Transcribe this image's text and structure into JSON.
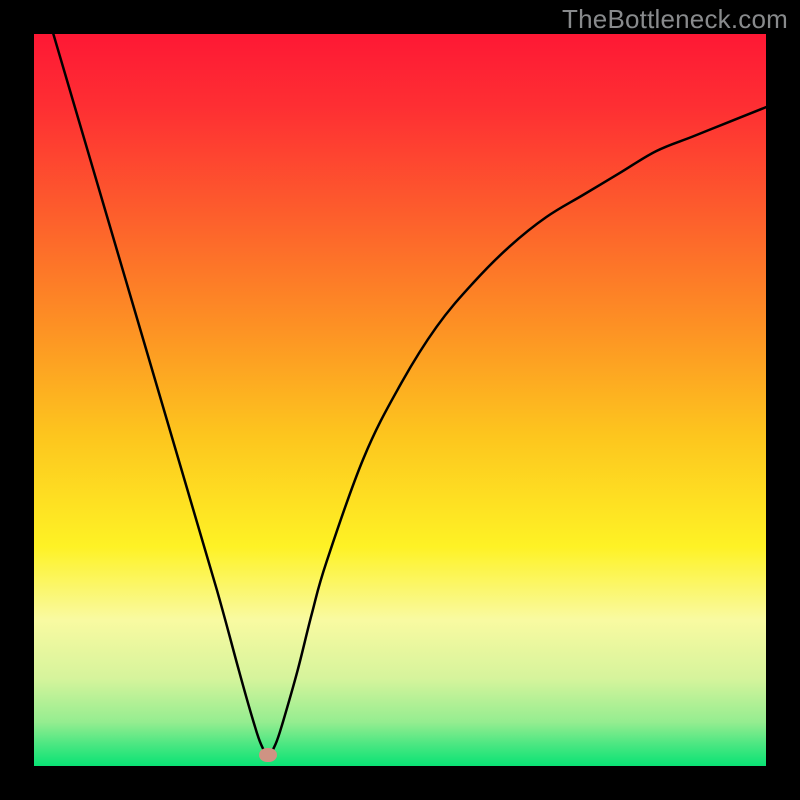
{
  "watermark": "TheBottleneck.com",
  "colors": {
    "frame": "#000000",
    "curve_stroke": "#000000",
    "marker": "#cf9383",
    "gradient_stops": [
      {
        "offset": 0.0,
        "color": "#fe1834"
      },
      {
        "offset": 0.1,
        "color": "#fe2f33"
      },
      {
        "offset": 0.25,
        "color": "#fd5f2c"
      },
      {
        "offset": 0.4,
        "color": "#fd9124"
      },
      {
        "offset": 0.55,
        "color": "#fdc61e"
      },
      {
        "offset": 0.7,
        "color": "#fef225"
      },
      {
        "offset": 0.8,
        "color": "#f9faa1"
      },
      {
        "offset": 0.88,
        "color": "#d6f49c"
      },
      {
        "offset": 0.94,
        "color": "#95ed90"
      },
      {
        "offset": 0.97,
        "color": "#4ce782"
      },
      {
        "offset": 1.0,
        "color": "#09e374"
      }
    ]
  },
  "chart_data": {
    "type": "line",
    "title": "",
    "xlabel": "",
    "ylabel": "",
    "xlim": [
      0,
      100
    ],
    "ylim": [
      0,
      100
    ],
    "grid": false,
    "legend": false,
    "series": [
      {
        "name": "bottleneck-curve",
        "x": [
          0,
          5,
          10,
          15,
          20,
          25,
          28,
          30,
          31,
          32,
          33,
          34,
          36,
          38,
          40,
          45,
          50,
          55,
          60,
          65,
          70,
          75,
          80,
          85,
          90,
          95,
          100
        ],
        "y": [
          109,
          92,
          75,
          58,
          41,
          24,
          13,
          6,
          3,
          1.5,
          3,
          6,
          13,
          21,
          28,
          42,
          52,
          60,
          66,
          71,
          75,
          78,
          81,
          84,
          86,
          88,
          90
        ]
      }
    ],
    "minimum_point": {
      "x": 32,
      "y": 1.5
    },
    "notes": "Values are approximate; y expressed as bottleneck percentage inferred from vertical position. Chart has no visible axes, ticks, or labels in the source image; background is a vertical red→orange→yellow→green gradient with a thick black frame."
  }
}
